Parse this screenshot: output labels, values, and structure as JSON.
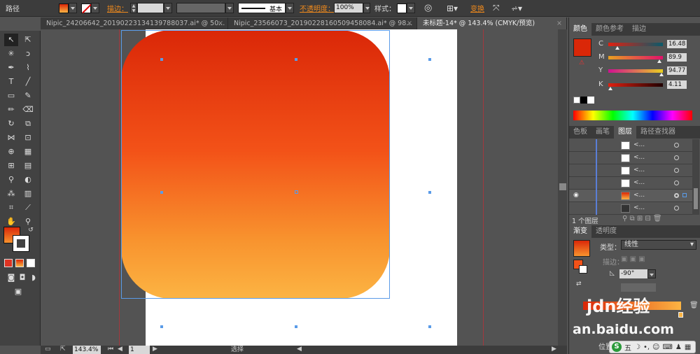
{
  "control_bar": {
    "object_type": "路径",
    "stroke_label": "描边：",
    "stroke_style": "基本",
    "opacity_label": "不透明度：",
    "opacity_value": "100%",
    "style_label": "样式：",
    "transform_label": "变换"
  },
  "tabs": [
    {
      "label": "Nipic_24206642_20190223134139788037.ai* @ 50...",
      "close": "×"
    },
    {
      "label": "Nipic_23566073_20190228160509458084.ai* @ 98...",
      "close": "×"
    },
    {
      "label": "未标题-14* @ 143.4% (CMYK/预览)",
      "close": "×"
    }
  ],
  "status_bar": {
    "zoom": "143.4%",
    "page": "1",
    "mode": "选择"
  },
  "color_panel": {
    "tabs": [
      "颜色",
      "颜色参考",
      "描边"
    ],
    "channels": [
      {
        "name": "C",
        "value": "16.48",
        "fill": 0.16
      },
      {
        "name": "M",
        "value": "89.9",
        "fill": 0.9
      },
      {
        "name": "Y",
        "value": "94.77",
        "fill": 0.95
      },
      {
        "name": "K",
        "value": "4.11",
        "fill": 0.04
      }
    ],
    "swatch_color": "#da2708"
  },
  "layers_panel": {
    "tabs": [
      "色板",
      "画笔",
      "图层",
      "路径查找器"
    ],
    "item_label": "<...",
    "count_label": "1 个图层"
  },
  "gradient_panel": {
    "tabs": [
      "渐变",
      "透明度"
    ],
    "type_label": "类型：",
    "type_value": "线性",
    "stroke_label": "描边：",
    "angle_value": "-90°",
    "position_label": "位置"
  },
  "watermark": {
    "site": "jdn经验",
    "url": "an.baidu.com"
  },
  "ime_bar": {
    "logo": "S",
    "text": "五"
  },
  "colors": {
    "gradient_top": "#da2708",
    "gradient_bottom": "#fcb443",
    "accent": "#f08a1c"
  }
}
